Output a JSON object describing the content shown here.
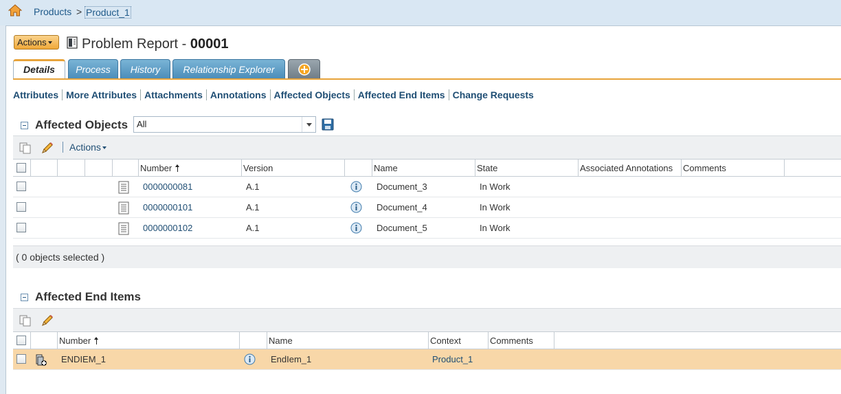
{
  "breadcrumb": {
    "items": [
      "Products",
      "Product_1"
    ],
    "separator": ">"
  },
  "header": {
    "actions_label": "Actions",
    "title_prefix": "Problem Report - ",
    "title_number": "00001"
  },
  "tabs": [
    {
      "label": "Details",
      "active": true
    },
    {
      "label": "Process",
      "active": false
    },
    {
      "label": "History",
      "active": false
    },
    {
      "label": "Relationship Explorer",
      "active": false
    }
  ],
  "subnav": [
    "Attributes",
    "More Attributes",
    "Attachments",
    "Annotations",
    "Affected Objects",
    "Affected End Items",
    "Change Requests"
  ],
  "affected_objects": {
    "title": "Affected Objects",
    "filter_value": "All",
    "toolbar_actions_label": "Actions",
    "columns": [
      "Number",
      "Version",
      "Name",
      "State",
      "Associated Annotations",
      "Comments"
    ],
    "rows": [
      {
        "number": "0000000081",
        "version": "A.1",
        "name": "Document_3",
        "state": "In Work"
      },
      {
        "number": "0000000101",
        "version": "A.1",
        "name": "Document_4",
        "state": "In Work"
      },
      {
        "number": "0000000102",
        "version": "A.1",
        "name": "Document_5",
        "state": "In Work"
      }
    ],
    "status": "( 0 objects selected )"
  },
  "affected_end_items": {
    "title": "Affected End Items",
    "columns": [
      "Number",
      "Name",
      "Context",
      "Comments"
    ],
    "rows": [
      {
        "number": "ENDIEM_1",
        "name": "EndIem_1",
        "context": "Product_1",
        "selected": true
      }
    ]
  },
  "colors": {
    "accent": "#e7a33a",
    "tab_blue": "#4a8cb8",
    "link": "#1f4e74",
    "selected_row": "#f8d7a8"
  }
}
